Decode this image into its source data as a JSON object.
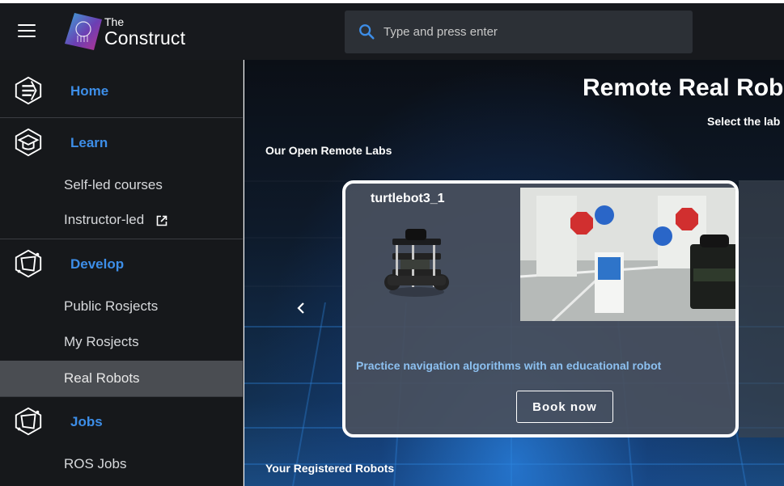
{
  "header": {
    "logo_the": "The",
    "logo_name": "Construct",
    "search_placeholder": "Type and press enter"
  },
  "sidebar": {
    "sections": [
      {
        "label": "Home",
        "icon": "home-icon"
      },
      {
        "label": "Learn",
        "icon": "learn-icon"
      },
      {
        "label": "Develop",
        "icon": "develop-icon"
      },
      {
        "label": "Jobs",
        "icon": "jobs-icon"
      }
    ],
    "learn_items": [
      "Self-led courses",
      "Instructor-led"
    ],
    "develop_items": [
      "Public Rosjects",
      "My Rosjects",
      "Real Robots"
    ],
    "jobs_items": [
      "ROS Jobs"
    ],
    "active_item": "Real Robots"
  },
  "main": {
    "title": "Remote Real Robo",
    "subtitle": "Select the lab",
    "open_labs_heading": "Our Open Remote Labs",
    "registered_heading": "Your Registered Robots",
    "card": {
      "robot_name": "turtlebot3_1",
      "description": "Practice navigation algorithms with an educational robot",
      "book_label": "Book now"
    }
  },
  "colors": {
    "accent_blue": "#3d8ee8",
    "sidebar_bg": "#16181b",
    "header_bg": "#17191d",
    "active_item_bg": "#4a4d52",
    "desc_blue": "#8cc0f0"
  }
}
